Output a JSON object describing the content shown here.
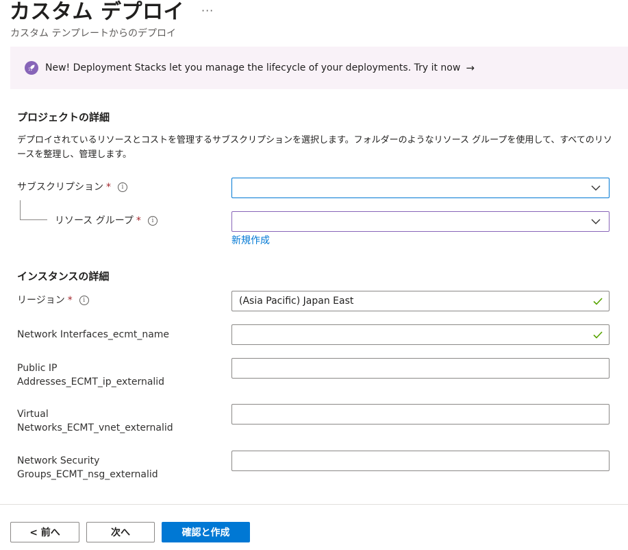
{
  "header": {
    "title": "カスタム デプロイ",
    "more": "···",
    "subtitle": "カスタム テンプレートからのデプロイ"
  },
  "banner": {
    "icon": "rocket-icon",
    "text": "New! Deployment Stacks let you manage the lifecycle of your deployments. Try it now",
    "arrow": "→"
  },
  "project": {
    "title": "プロジェクトの詳細",
    "description": "デプロイされているリソースとコストを管理するサブスクリプションを選択します。フォルダーのようなリソース グループを使用して、すべてのリソースを整理し、管理します。",
    "subscription_label": "サブスクリプション",
    "subscription_value": "",
    "resource_group_label": "リソース グループ",
    "resource_group_value": "",
    "new_link": "新規作成"
  },
  "instance": {
    "title": "インスタンスの詳細",
    "region_label": "リージョン",
    "region_value": "(Asia Pacific) Japan East",
    "nic_label": "Network Interfaces_ecmt_name",
    "nic_value": "",
    "pip_label_1": "Public IP",
    "pip_label_2": "Addresses_ECMT_ip_externalid",
    "pip_value": "",
    "vnet_label_1": "Virtual",
    "vnet_label_2": "Networks_ECMT_vnet_externalid",
    "vnet_value": "",
    "nsg_label_1": "Network Security",
    "nsg_label_2": "Groups_ECMT_nsg_externalid",
    "nsg_value": ""
  },
  "required_mark": "*",
  "info_glyph": "i",
  "footer": {
    "prev": "< 前へ",
    "next": "次へ",
    "create": "確認と作成"
  },
  "colors": {
    "accent": "#0078d4",
    "required": "#a4262c",
    "valid": "#57a300",
    "banner_bg": "#f9f2f8",
    "rocket": "#8764b8",
    "focus_border_subscription": "#0078d4",
    "focus_border_resource_group": "#8764b8"
  }
}
